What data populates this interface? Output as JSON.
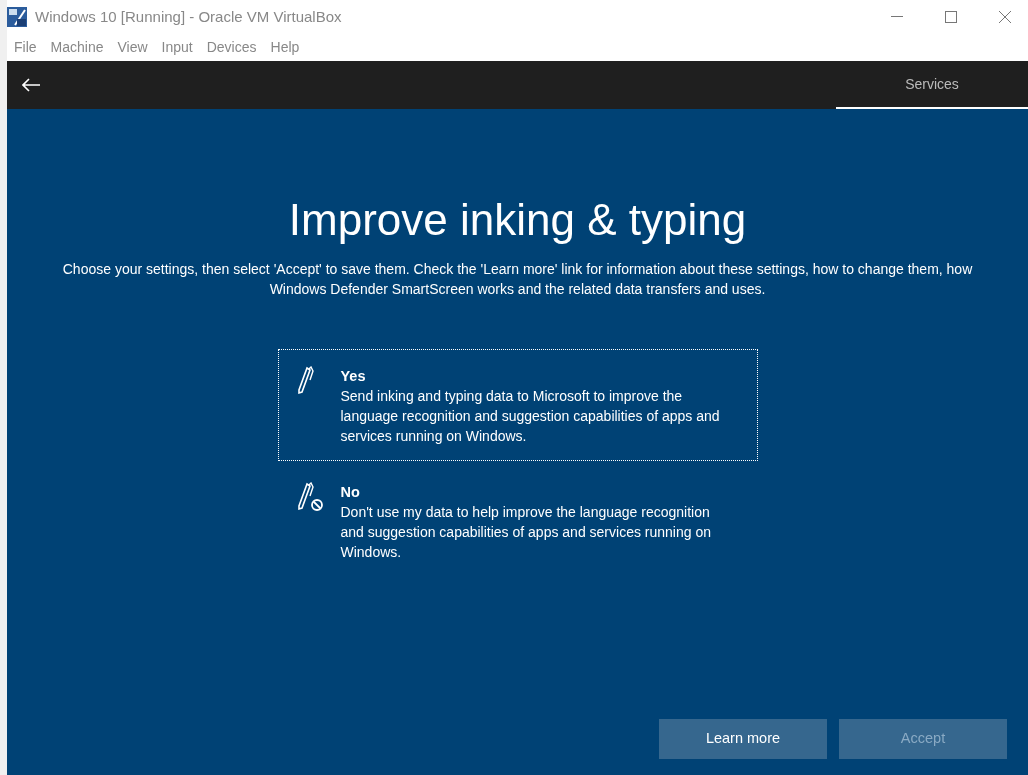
{
  "window": {
    "title": "Windows 10 [Running] - Oracle VM VirtualBox"
  },
  "menu": [
    "File",
    "Machine",
    "View",
    "Input",
    "Devices",
    "Help"
  ],
  "steps": [
    {
      "label": "Services",
      "selected": true
    }
  ],
  "heading": "Improve inking & typing",
  "intro": "Choose your settings, then select 'Accept' to save them. Check the 'Learn more' link for information about these settings, how to change them, how Windows Defender SmartScreen works and the related data transfers and uses.",
  "options": [
    {
      "kind": "yes",
      "title": "Yes",
      "text": "Send inking and typing data to Microsoft to improve the language recognition and suggestion capabilities of apps and services running on Windows.",
      "selected": true
    },
    {
      "kind": "no",
      "title": "No",
      "text": "Don't use my data to help improve the language recognition and suggestion capabilities of apps and services running on Windows.",
      "selected": false
    }
  ],
  "buttons": [
    {
      "label": "Learn more",
      "disabled": false
    },
    {
      "label": "Accept",
      "disabled": true
    }
  ]
}
